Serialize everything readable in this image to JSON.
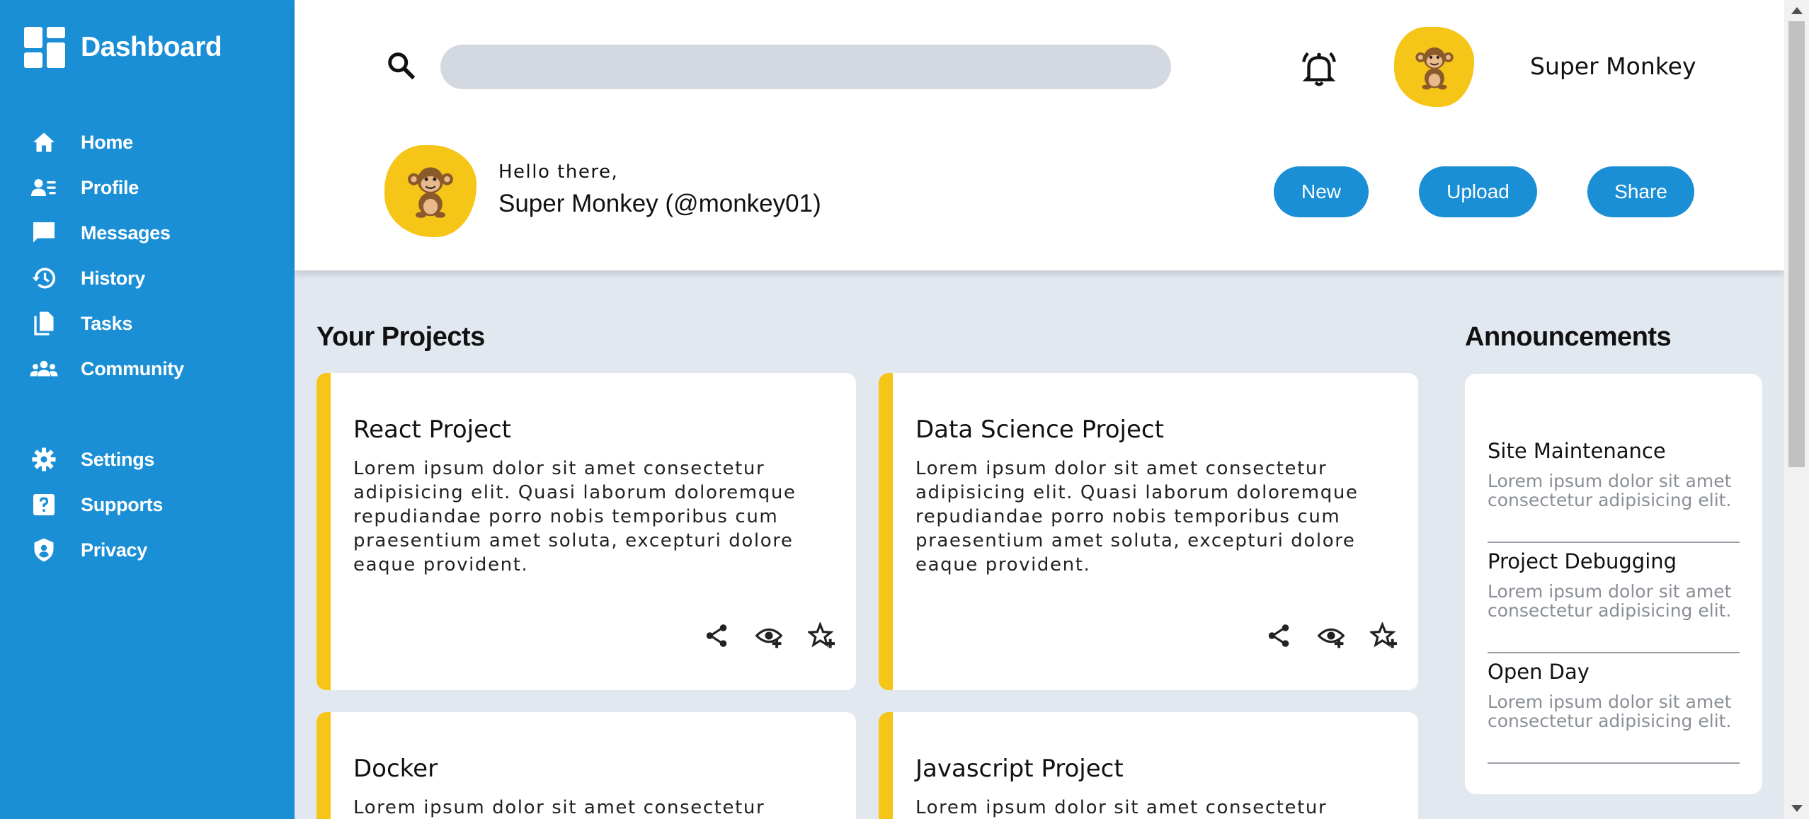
{
  "sidebar": {
    "brand": "Dashboard",
    "items": [
      {
        "label": "Home",
        "icon": "home-icon"
      },
      {
        "label": "Profile",
        "icon": "profile-icon"
      },
      {
        "label": "Messages",
        "icon": "messages-icon"
      },
      {
        "label": "History",
        "icon": "history-icon"
      },
      {
        "label": "Tasks",
        "icon": "tasks-icon"
      },
      {
        "label": "Community",
        "icon": "community-icon"
      },
      {
        "label": "Settings",
        "icon": "settings-icon"
      },
      {
        "label": "Supports",
        "icon": "supports-icon"
      },
      {
        "label": "Privacy",
        "icon": "privacy-icon"
      }
    ]
  },
  "header": {
    "search": {
      "value": "",
      "placeholder": ""
    },
    "user_name": "Super Monkey",
    "greeting": "Hello there,",
    "greeting_name": "Super Monkey (@monkey01)",
    "buttons": {
      "new": "New",
      "upload": "Upload",
      "share": "Share"
    }
  },
  "projects": {
    "title": "Your Projects",
    "items": [
      {
        "name": "React Project",
        "description": "Lorem ipsum dolor sit amet consectetur adipisicing elit. Quasi laborum doloremque repudiandae porro nobis temporibus cum praesentium amet soluta, excepturi dolore eaque provident."
      },
      {
        "name": "Data Science Project",
        "description": "Lorem ipsum dolor sit amet consectetur adipisicing elit. Quasi laborum doloremque repudiandae porro nobis temporibus cum praesentium amet soluta, excepturi dolore eaque provident."
      },
      {
        "name": "Docker",
        "description": "Lorem ipsum dolor sit amet consectetur"
      },
      {
        "name": "Javascript Project",
        "description": "Lorem ipsum dolor sit amet consectetur"
      }
    ]
  },
  "announcements": {
    "title": "Announcements",
    "items": [
      {
        "title": "Site Maintenance",
        "text": "Lorem ipsum dolor sit amet consectetur adipisicing elit."
      },
      {
        "title": "Project Debugging",
        "text": "Lorem ipsum dolor sit amet consectetur adipisicing elit."
      },
      {
        "title": "Open Day",
        "text": "Lorem ipsum dolor sit amet consectetur adipisicing elit."
      }
    ]
  },
  "colors": {
    "sidebar": "#1b8fd6",
    "accent": "#f5c518",
    "background": "#e2e8f0"
  }
}
